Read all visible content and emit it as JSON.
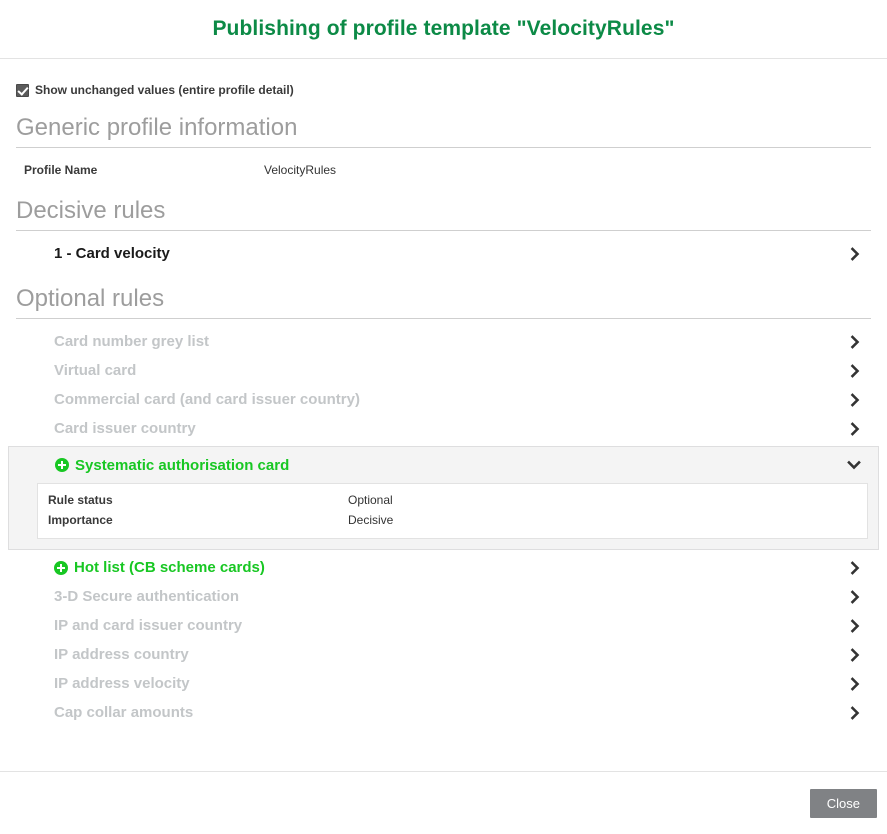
{
  "header": {
    "title": "Publishing of profile template \"VelocityRules\""
  },
  "options": {
    "show_unchanged_label": "Show unchanged values (entire profile detail)",
    "show_unchanged_checked": true
  },
  "sections": {
    "generic": {
      "title": "Generic profile information",
      "rows": [
        {
          "key": "Profile Name",
          "value": "VelocityRules"
        }
      ]
    },
    "decisive": {
      "title": "Decisive rules",
      "rules": [
        {
          "label": "1 - Card velocity",
          "state": "decisive",
          "chevron": "chevron-right-icon"
        }
      ]
    },
    "optional": {
      "title": "Optional rules",
      "rules": [
        {
          "label": "Card number grey list",
          "state": "disabled",
          "chevron": "chevron-right-icon"
        },
        {
          "label": "Virtual card",
          "state": "disabled",
          "chevron": "chevron-right-icon"
        },
        {
          "label": "Commercial card (and card issuer country)",
          "state": "disabled",
          "chevron": "chevron-right-icon"
        },
        {
          "label": "Card issuer country",
          "state": "disabled",
          "chevron": "chevron-right-icon"
        }
      ],
      "expanded_rule": {
        "label": "Systematic authorisation card",
        "state": "active",
        "icon": "plus-circle-icon",
        "chevron": "chevron-down-icon",
        "details": [
          {
            "key": "Rule status",
            "value": "Optional"
          },
          {
            "key": "Importance",
            "value": "Decisive"
          }
        ]
      },
      "rules_after": [
        {
          "label": "Hot list (CB scheme cards)",
          "state": "active",
          "icon": "plus-circle-icon",
          "chevron": "chevron-right-icon"
        },
        {
          "label": "3-D Secure authentication",
          "state": "disabled",
          "chevron": "chevron-right-icon"
        },
        {
          "label": "IP and card issuer country",
          "state": "disabled",
          "chevron": "chevron-right-icon"
        },
        {
          "label": "IP address country",
          "state": "disabled",
          "chevron": "chevron-right-icon"
        },
        {
          "label": "IP address velocity",
          "state": "disabled",
          "chevron": "chevron-right-icon"
        },
        {
          "label": "Cap collar amounts",
          "state": "disabled",
          "chevron": "chevron-right-icon"
        }
      ]
    }
  },
  "footer": {
    "close_label": "Close"
  },
  "colors": {
    "title_green": "#0c8a46",
    "accent_green": "#18c723",
    "disabled_gray": "#c3c6c8",
    "button_gray": "#808285"
  }
}
